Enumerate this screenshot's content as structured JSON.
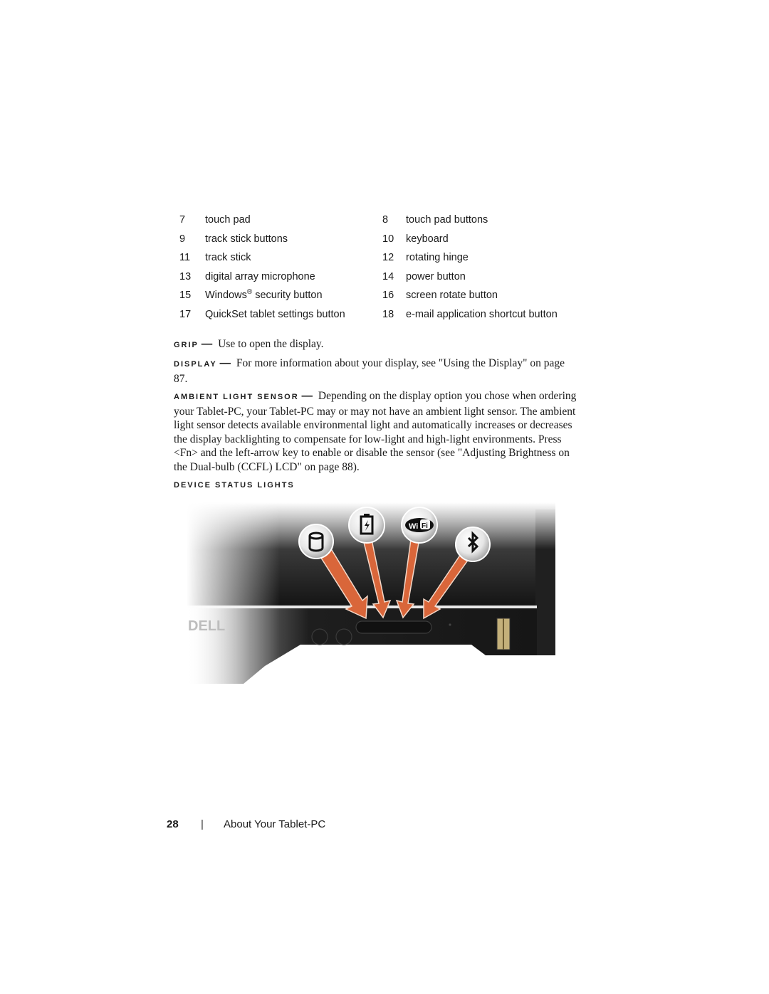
{
  "legend": {
    "rows": [
      {
        "left": {
          "num": "7",
          "label": "touch pad"
        },
        "right": {
          "num": "8",
          "label": "touch pad buttons"
        }
      },
      {
        "left": {
          "num": "9",
          "label": "track stick buttons"
        },
        "right": {
          "num": "10",
          "label": "keyboard"
        }
      },
      {
        "left": {
          "num": "11",
          "label": "track stick"
        },
        "right": {
          "num": "12",
          "label": "rotating hinge"
        }
      },
      {
        "left": {
          "num": "13",
          "label": "digital array microphone"
        },
        "right": {
          "num": "14",
          "label": "power button"
        }
      },
      {
        "left": {
          "num": "15",
          "label": "Windows",
          "sup": "®",
          "label_suffix": " security button"
        },
        "right": {
          "num": "16",
          "label": "screen rotate button"
        }
      },
      {
        "left": {
          "num": "17",
          "label": "QuickSet tablet settings button"
        },
        "right": {
          "num": "18",
          "label": "e-mail application shortcut button"
        }
      }
    ]
  },
  "sections": {
    "grip": {
      "term": "GRIP",
      "dash": "—",
      "text": "Use to open the display."
    },
    "display": {
      "term": "DISPLAY",
      "dash": "—",
      "text": "For more information about your display, see \"Using the Display\" on page 87."
    },
    "ambient": {
      "term": "AMBIENT LIGHT SENSOR",
      "dash": "—",
      "text": "Depending on the display option you chose when ordering your Tablet-PC, your Tablet-PC may or may not have an ambient light sensor. The ambient light sensor detects available environmental light and automatically increases or decreases the display backlighting to compensate for low-light and high-light environments. Press <Fn> and the left-arrow key to enable or disable the sensor (see \"Adjusting Brightness on the Dual-bulb (CCFL) LCD\" on page 88)."
    },
    "device_status_lights": {
      "heading": "DEVICE STATUS LIGHTS"
    }
  },
  "figure": {
    "icons": [
      "hard-drive-icon",
      "battery-icon",
      "wifi-icon",
      "bluetooth-icon"
    ],
    "wifi_text_a": "Wi",
    "wifi_text_b": "Fi",
    "brand": "DELL",
    "arrow_color": "#d9663a"
  },
  "footer": {
    "page_number": "28",
    "separator": "|",
    "chapter": "About Your Tablet-PC"
  }
}
